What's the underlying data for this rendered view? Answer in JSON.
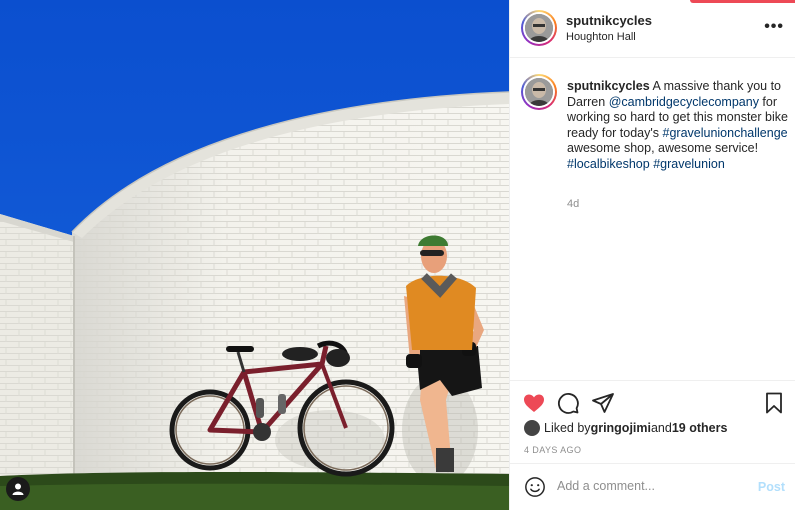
{
  "colors": {
    "sky": "#0f55d3",
    "wall": "#f0efe8",
    "grass": "#2c4a1a",
    "jersey": "#e08a22",
    "bike": "#7a1f2c",
    "like_red": "#ed4956",
    "link_blue": "#00376b",
    "post_disabled": "#b2dffc"
  },
  "post": {
    "username": "sputnikcycles",
    "location": "Houghton Hall",
    "more_icon": "more-dots-icon"
  },
  "caption": {
    "username": "sputnikcycles",
    "text_1": " A massive thank you to Darren ",
    "mention": "@cambridgecyclecompany",
    "text_2": " for working so hard to get this monster bike ready for today's ",
    "hashtag_1": "#gravelunionchallenge",
    "text_3": " awesome shop, awesome service! ",
    "hashtag_2": "#localbikeshop",
    "text_4": " ",
    "hashtag_3": "#gravelunion",
    "time": "4d"
  },
  "actions": {
    "like_icon": "heart-filled-icon",
    "comment_icon": "comment-icon",
    "share_icon": "paper-plane-icon",
    "save_icon": "bookmark-icon"
  },
  "likes": {
    "prefix": "Liked by ",
    "user": "gringojimi",
    "middle": " and ",
    "others": "19 others"
  },
  "date": "4 DAYS AGO",
  "comment": {
    "placeholder": "Add a comment...",
    "post_label": "Post"
  }
}
